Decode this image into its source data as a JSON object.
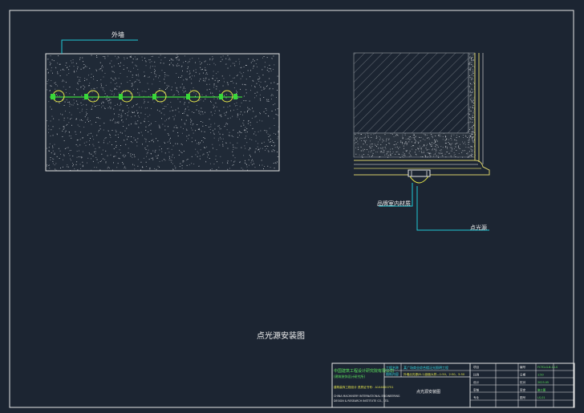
{
  "colors": {
    "background": "#1c2532",
    "frame": "#e6e6e6",
    "leader": "#21c9d6",
    "fixture": "#e8e84a",
    "connector": "#39d83a",
    "title_text": "#f2f2f2",
    "tb_cyan": "#37d6e3",
    "tb_green": "#5ce35c",
    "tb_yellow": "#e6e64d"
  },
  "elevation": {
    "callout_label": "外墙"
  },
  "section": {
    "left_callout_label": "品牌室内材质",
    "right_callout_label": "点光源"
  },
  "drawing_title": "点光源安装图",
  "title_block": {
    "company_cn_line1": "中国建筑工程设计研究院有限公司",
    "company_cn_line2": "(建筑装饰设计研究所)",
    "company_cn_line3": "建筑装饰工程设计  资质证书号：A144000751",
    "company_en_line1": "CHINA MACHINERY INTERNATIONAL ENGINEERING",
    "company_en_line2": "DESIGN & RESEARCH INSTITUTE CO., LTD.",
    "project_label": "工程名称",
    "project_name": "某广场商业综合楼泛光照明工程",
    "content_label": "图纸内容",
    "content_name": "外墙点光源(B-1)剖面大样—1:50、2:50、5:50",
    "drawing_name_cell": "点光源安装图",
    "right_labels": [
      "项目",
      "编号",
      "比例",
      "日期",
      "设计",
      "校对",
      "审核",
      "审定",
      "专业",
      "图号"
    ],
    "right_values": [
      "FCTCLG-B-1-LS",
      "1:50",
      "2023.05",
      "施工图",
      "LS-01"
    ]
  }
}
